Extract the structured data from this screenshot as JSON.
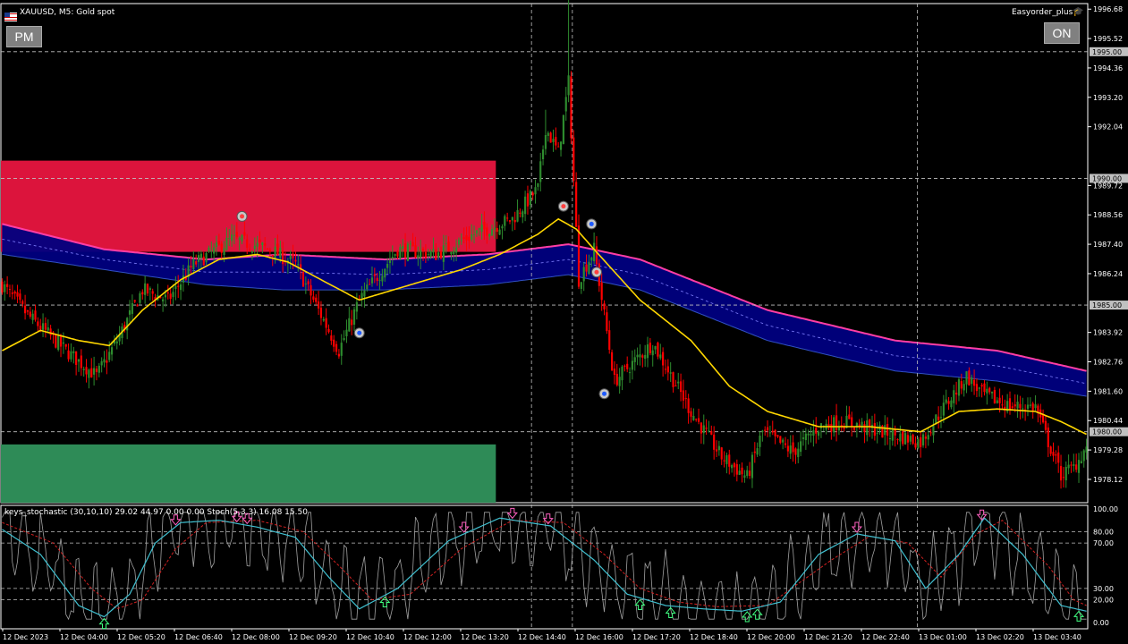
{
  "header": {
    "symbol_title": "XAUUSD, M5:  Gold spot",
    "ea_name": "Easyorder_plus",
    "indicator_label": "keys_stochastic (30,10,10) 29.02 44.97 0.00 0.00 Stoch(5,3,3) 16.08 15.50"
  },
  "buttons": {
    "left": "PM",
    "right": "ON"
  },
  "colors": {
    "bull": "#2e8b2e",
    "bear": "#ff0000",
    "ema": "#ffd700",
    "band_fill": "#000080",
    "band_upper": "#ff3ea5",
    "band_lower": "#1ea0ff",
    "supply_zone": "#dc143c",
    "demand_zone": "#2e8b57",
    "stoch_k": "#40c0d0",
    "stoch_d": "#d02020",
    "fast_stoch": "#a0a0a0"
  },
  "chart_data": {
    "type": "candlestick",
    "symbol": "XAUUSD",
    "timeframe": "M5",
    "ylim": [
      1977.2,
      1996.9
    ],
    "price_ticks": [
      "1996.68",
      "1995.52",
      "1994.36",
      "1993.20",
      "1992.04",
      "1989.72",
      "1988.56",
      "1987.40",
      "1986.24",
      "1983.92",
      "1982.76",
      "1981.60",
      "1980.44",
      "1979.28",
      "1978.12"
    ],
    "price_marks": [
      "1995.00",
      "1990.00",
      "1985.00",
      "1980.00"
    ],
    "time_labels": [
      "12 Dec 2023",
      "12 Dec 04:00",
      "12 Dec 05:20",
      "12 Dec 06:40",
      "12 Dec 08:00",
      "12 Dec 09:20",
      "12 Dec 10:40",
      "12 Dec 12:00",
      "12 Dec 13:20",
      "12 Dec 14:40",
      "12 Dec 16:00",
      "12 Dec 17:20",
      "12 Dec 18:40",
      "12 Dec 20:00",
      "12 Dec 21:20",
      "12 Dec 22:40",
      "13 Dec 01:00",
      "13 Dec 02:20",
      "13 Dec 03:40"
    ],
    "close_path": [
      [
        0,
        1985.8
      ],
      [
        10,
        1984.6
      ],
      [
        25,
        1983.2
      ],
      [
        37,
        1982.2
      ],
      [
        45,
        1983.6
      ],
      [
        55,
        1985.6
      ],
      [
        65,
        1985.2
      ],
      [
        75,
        1986.6
      ],
      [
        90,
        1987.6
      ],
      [
        105,
        1987.2
      ],
      [
        115,
        1986.6
      ],
      [
        125,
        1984.6
      ],
      [
        132,
        1983.2
      ],
      [
        140,
        1985.2
      ],
      [
        155,
        1987.2
      ],
      [
        170,
        1987.0
      ],
      [
        185,
        1987.8
      ],
      [
        200,
        1988.4
      ],
      [
        210,
        1989.6
      ],
      [
        213,
        1992.0
      ],
      [
        218,
        1991.0
      ],
      [
        222,
        1993.8
      ],
      [
        226,
        1986.0
      ],
      [
        232,
        1987.2
      ],
      [
        240,
        1982.0
      ],
      [
        255,
        1983.5
      ],
      [
        270,
        1980.8
      ],
      [
        282,
        1979.0
      ],
      [
        292,
        1978.2
      ],
      [
        298,
        1980.0
      ],
      [
        310,
        1979.2
      ],
      [
        320,
        1980.2
      ],
      [
        330,
        1980.4
      ],
      [
        345,
        1980.0
      ],
      [
        360,
        1979.6
      ],
      [
        368,
        1980.8
      ],
      [
        378,
        1982.2
      ],
      [
        384,
        1981.5
      ],
      [
        395,
        1981.0
      ],
      [
        405,
        1981.0
      ],
      [
        410,
        1979.6
      ],
      [
        415,
        1978.3
      ],
      [
        420,
        1978.6
      ],
      [
        425,
        1979.4
      ]
    ],
    "ema_path": [
      [
        0,
        1983.2
      ],
      [
        15,
        1984.0
      ],
      [
        30,
        1983.6
      ],
      [
        42,
        1983.4
      ],
      [
        55,
        1984.8
      ],
      [
        70,
        1986.0
      ],
      [
        85,
        1986.8
      ],
      [
        100,
        1987.0
      ],
      [
        112,
        1986.7
      ],
      [
        125,
        1986.0
      ],
      [
        140,
        1985.2
      ],
      [
        160,
        1985.8
      ],
      [
        180,
        1986.4
      ],
      [
        195,
        1987.0
      ],
      [
        210,
        1987.8
      ],
      [
        218,
        1988.4
      ],
      [
        225,
        1988.0
      ],
      [
        232,
        1987.2
      ],
      [
        250,
        1985.2
      ],
      [
        270,
        1983.6
      ],
      [
        285,
        1981.8
      ],
      [
        300,
        1980.8
      ],
      [
        320,
        1980.2
      ],
      [
        340,
        1980.2
      ],
      [
        360,
        1980.0
      ],
      [
        375,
        1980.8
      ],
      [
        390,
        1980.9
      ],
      [
        405,
        1980.8
      ],
      [
        415,
        1980.4
      ],
      [
        425,
        1979.9
      ]
    ],
    "band_upper_path": [
      [
        0,
        1988.2
      ],
      [
        40,
        1987.2
      ],
      [
        80,
        1986.8
      ],
      [
        110,
        1987.0
      ],
      [
        150,
        1986.8
      ],
      [
        190,
        1987.0
      ],
      [
        222,
        1987.4
      ],
      [
        250,
        1986.8
      ],
      [
        300,
        1984.8
      ],
      [
        350,
        1983.6
      ],
      [
        390,
        1983.2
      ],
      [
        425,
        1982.4
      ]
    ],
    "band_lower_path": [
      [
        0,
        1987.0
      ],
      [
        40,
        1986.4
      ],
      [
        80,
        1985.8
      ],
      [
        110,
        1985.6
      ],
      [
        150,
        1985.6
      ],
      [
        190,
        1985.8
      ],
      [
        222,
        1986.2
      ],
      [
        250,
        1985.6
      ],
      [
        300,
        1983.6
      ],
      [
        350,
        1982.4
      ],
      [
        390,
        1982.0
      ],
      [
        425,
        1981.4
      ]
    ],
    "supply_zone": {
      "x0": 0,
      "x1": 194,
      "y0": 1990.7,
      "y1": 1987.1
    },
    "demand_zone": {
      "x0": 0,
      "x1": 194,
      "y0": 1979.5,
      "y1": 1977.2
    },
    "signals": [
      [
        94,
        1988.5,
        "sell"
      ],
      [
        140,
        1983.9,
        "buy"
      ],
      [
        220,
        1988.9,
        "sell"
      ],
      [
        231,
        1988.2,
        "buy"
      ],
      [
        233,
        1986.3,
        "sell"
      ],
      [
        236,
        1981.5,
        "buy"
      ]
    ],
    "stochastic": {
      "ylim": [
        0,
        100
      ],
      "ticks": [
        "100.00",
        "80.00",
        "70.00",
        "30.00",
        "20.00",
        "0.00"
      ],
      "k_path": [
        [
          0,
          82
        ],
        [
          15,
          60
        ],
        [
          30,
          15
        ],
        [
          40,
          5
        ],
        [
          50,
          25
        ],
        [
          60,
          70
        ],
        [
          70,
          88
        ],
        [
          85,
          90
        ],
        [
          100,
          84
        ],
        [
          115,
          75
        ],
        [
          128,
          40
        ],
        [
          140,
          12
        ],
        [
          155,
          30
        ],
        [
          175,
          72
        ],
        [
          195,
          92
        ],
        [
          215,
          85
        ],
        [
          232,
          55
        ],
        [
          245,
          25
        ],
        [
          260,
          15
        ],
        [
          275,
          12
        ],
        [
          290,
          10
        ],
        [
          305,
          18
        ],
        [
          320,
          60
        ],
        [
          335,
          78
        ],
        [
          350,
          72
        ],
        [
          362,
          30
        ],
        [
          375,
          60
        ],
        [
          385,
          92
        ],
        [
          400,
          60
        ],
        [
          415,
          15
        ],
        [
          425,
          10
        ]
      ],
      "d_path": [
        [
          0,
          88
        ],
        [
          20,
          70
        ],
        [
          35,
          30
        ],
        [
          45,
          12
        ],
        [
          55,
          20
        ],
        [
          68,
          65
        ],
        [
          80,
          88
        ],
        [
          100,
          90
        ],
        [
          118,
          80
        ],
        [
          132,
          50
        ],
        [
          145,
          20
        ],
        [
          160,
          25
        ],
        [
          180,
          65
        ],
        [
          200,
          90
        ],
        [
          220,
          88
        ],
        [
          236,
          60
        ],
        [
          250,
          30
        ],
        [
          265,
          18
        ],
        [
          280,
          14
        ],
        [
          300,
          15
        ],
        [
          325,
          55
        ],
        [
          340,
          76
        ],
        [
          355,
          70
        ],
        [
          368,
          40
        ],
        [
          382,
          78
        ],
        [
          392,
          90
        ],
        [
          410,
          50
        ],
        [
          420,
          20
        ],
        [
          425,
          15
        ]
      ],
      "up_arrows": [
        40,
        150,
        250,
        262,
        292,
        296,
        422
      ],
      "down_arrows": [
        68,
        92,
        96,
        181,
        200,
        214,
        335,
        384
      ]
    }
  }
}
